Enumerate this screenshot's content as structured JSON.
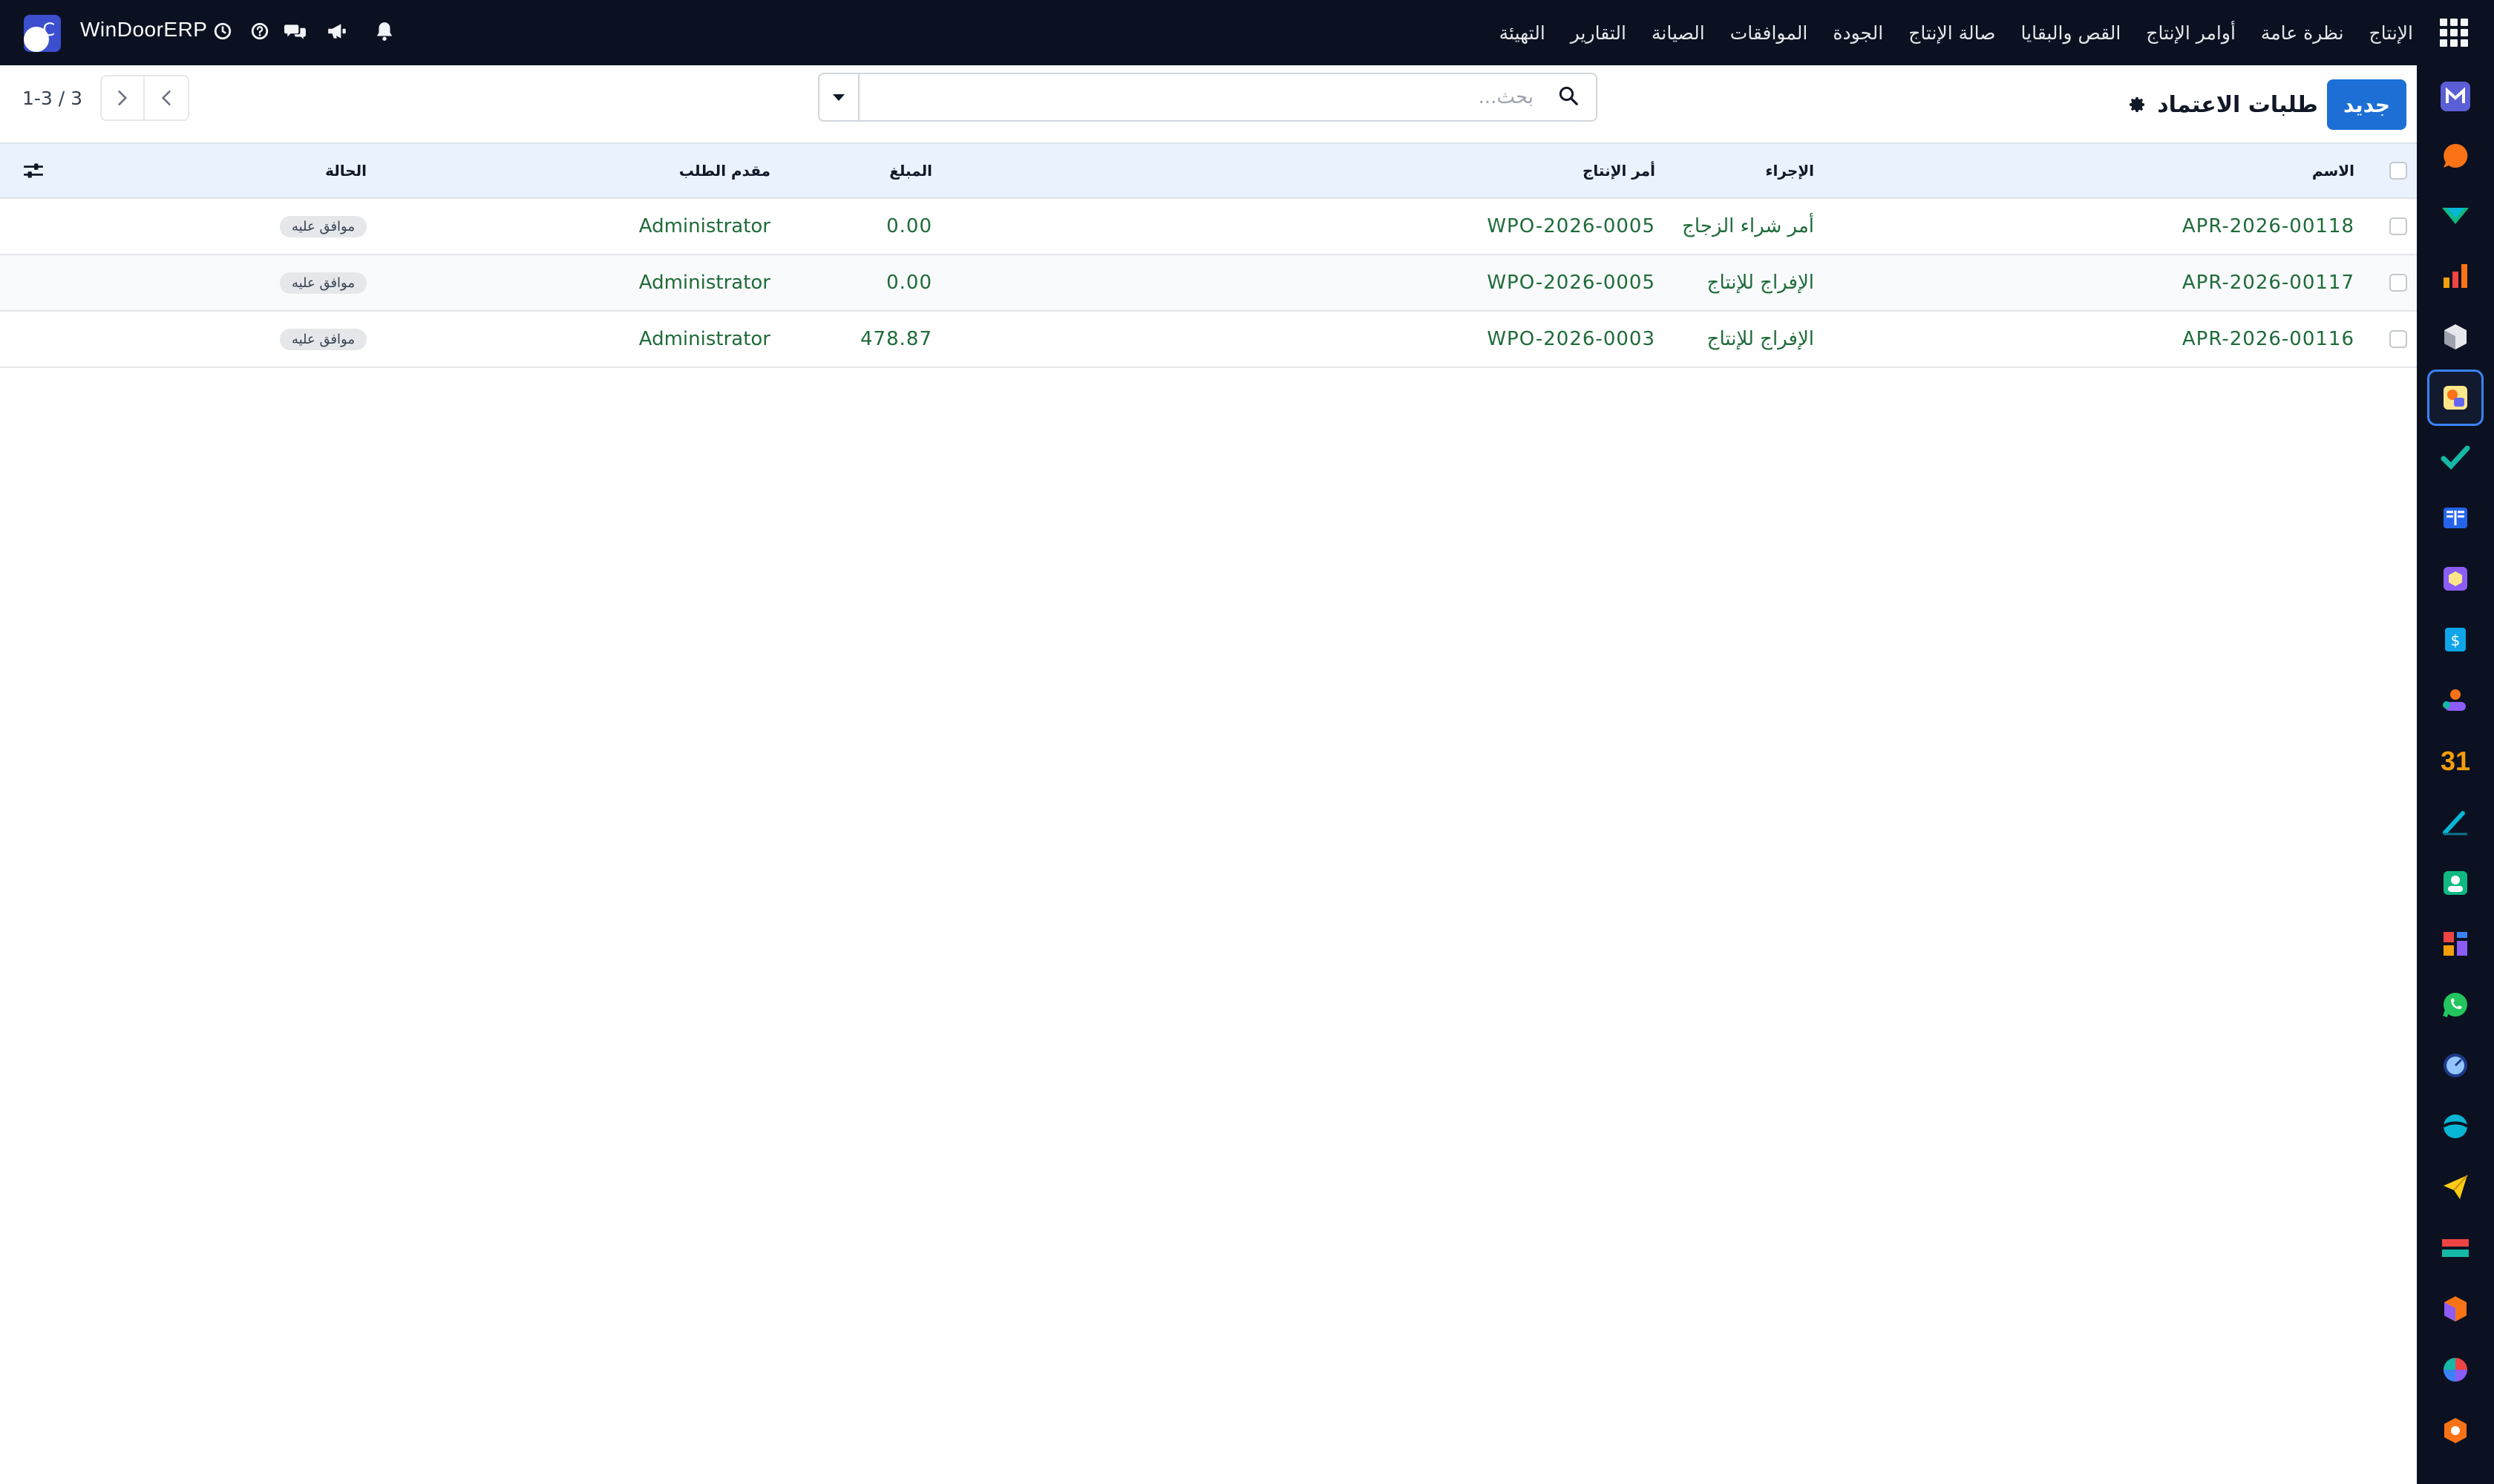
{
  "topbar": {
    "brand_name": "WinDoorERP",
    "brand_letter": "C",
    "menu": [
      "الإنتاج",
      "نظرة عامة",
      "أوامر الإنتاج",
      "القص والبقايا",
      "صالة الإنتاج",
      "الجودة",
      "الموافقات",
      "الصيانة",
      "التقارير",
      "التهيئة"
    ],
    "icons": [
      "bell-icon",
      "megaphone-icon",
      "chat-icon",
      "help-icon",
      "clock-icon"
    ]
  },
  "control_panel": {
    "new_label": "جديد",
    "title": "طلبات الاعتماد",
    "search_placeholder": "بحث...",
    "pager_text": "1-3 / 3"
  },
  "table": {
    "headers": {
      "name": "الاسم",
      "action": "الإجراء",
      "order": "أمر الإنتاج",
      "amount": "المبلغ",
      "requester": "مقدم الطلب",
      "status": "الحالة"
    },
    "rows": [
      {
        "name": "APR-2026-00118",
        "action": "أمر شراء الزجاج",
        "order": "WPO-2026-0005",
        "amount": "0.00",
        "requester": "Administrator",
        "status": "موافق عليه"
      },
      {
        "name": "APR-2026-00117",
        "action": "الإفراج للإنتاج",
        "order": "WPO-2026-0005",
        "amount": "0.00",
        "requester": "Administrator",
        "status": "موافق عليه"
      },
      {
        "name": "APR-2026-00116",
        "action": "الإفراج للإنتاج",
        "order": "WPO-2026-0003",
        "amount": "478.87",
        "requester": "Administrator",
        "status": "موافق عليه"
      }
    ]
  },
  "sidebar": {
    "apps": [
      "mail-app-icon",
      "discuss-app-icon",
      "sales-app-icon",
      "reports-app-icon",
      "inventory-app-icon",
      "approvals-app-icon",
      "todo-app-icon",
      "knowledge-app-icon",
      "manufacturing-app-icon",
      "invoicing-app-icon",
      "employees-app-icon",
      "calendar-app-icon",
      "sign-app-icon",
      "contacts-app-icon",
      "dashboards-app-icon",
      "whatsapp-app-icon",
      "timesheet-app-icon",
      "website-app-icon",
      "email-marketing-app-icon",
      "payroll-app-icon",
      "quality-app-icon",
      "survey-app-icon",
      "studio-app-icon"
    ],
    "calendar_label": "31"
  },
  "colors": {
    "navbar": "#0b1120",
    "primary": "#1d6fd6",
    "link_text": "#1f6b3a",
    "header_bg": "#eaf3fd"
  }
}
